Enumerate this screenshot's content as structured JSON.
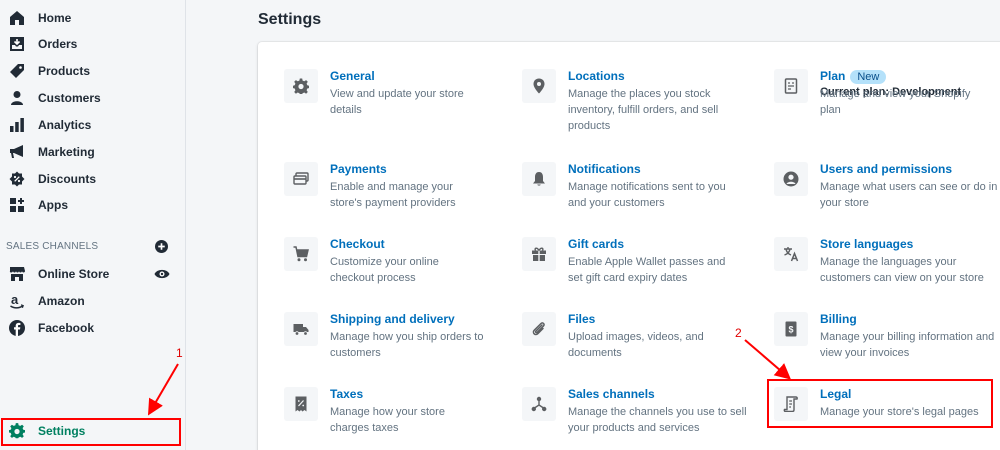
{
  "sidebar": {
    "items": [
      {
        "label": "Home",
        "icon": "home-icon"
      },
      {
        "label": "Orders",
        "icon": "orders-icon"
      },
      {
        "label": "Products",
        "icon": "tag-icon"
      },
      {
        "label": "Customers",
        "icon": "person-icon"
      },
      {
        "label": "Analytics",
        "icon": "bar-chart-icon"
      },
      {
        "label": "Marketing",
        "icon": "megaphone-icon"
      },
      {
        "label": "Discounts",
        "icon": "discount-icon"
      },
      {
        "label": "Apps",
        "icon": "apps-icon"
      }
    ],
    "channels_header": "SALES CHANNELS",
    "channels": [
      {
        "label": "Online Store",
        "icon": "store-icon"
      },
      {
        "label": "Amazon",
        "icon": "amazon-icon"
      },
      {
        "label": "Facebook",
        "icon": "facebook-icon"
      }
    ],
    "settings_label": "Settings"
  },
  "main": {
    "title": "Settings",
    "settings": {
      "general": {
        "title": "General",
        "desc": "View and update your store details"
      },
      "locations": {
        "title": "Locations",
        "desc": "Manage the places you stock inventory, fulfill orders, and sell products"
      },
      "plan": {
        "title": "Plan",
        "badge": "New",
        "current": "Current plan: Development",
        "desc": "Manage and view your Shopify plan"
      },
      "payments": {
        "title": "Payments",
        "desc": "Enable and manage your store's payment providers"
      },
      "notifications": {
        "title": "Notifications",
        "desc": "Manage notifications sent to you and your customers"
      },
      "users": {
        "title": "Users and permissions",
        "desc": "Manage what users can see or do in your store"
      },
      "checkout": {
        "title": "Checkout",
        "desc": "Customize your online checkout process"
      },
      "gift_cards": {
        "title": "Gift cards",
        "desc": "Enable Apple Wallet passes and set gift card expiry dates"
      },
      "languages": {
        "title": "Store languages",
        "desc": "Manage the languages your customers can view on your store"
      },
      "shipping": {
        "title": "Shipping and delivery",
        "desc": "Manage how you ship orders to customers"
      },
      "files": {
        "title": "Files",
        "desc": "Upload images, videos, and documents"
      },
      "billing": {
        "title": "Billing",
        "desc": "Manage your billing information and view your invoices"
      },
      "taxes": {
        "title": "Taxes",
        "desc": "Manage how your store charges taxes"
      },
      "sales_channels": {
        "title": "Sales channels",
        "desc": "Manage the channels you use to sell your products and services"
      },
      "legal": {
        "title": "Legal",
        "desc": "Manage your store's legal pages"
      }
    }
  },
  "annotations": {
    "step1": "1",
    "step2": "2"
  },
  "colors": {
    "link": "#006fbb",
    "accent": "#008060",
    "annotation": "#ff0000",
    "icon": "#5c5f62"
  }
}
